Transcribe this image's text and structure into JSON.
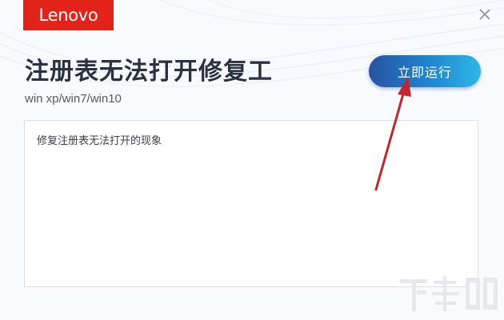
{
  "brand": {
    "logo_text": "Lenovo",
    "color": "#e2231a"
  },
  "window": {
    "close_icon": "close-icon"
  },
  "header": {
    "title": "注册表无法打开修复工",
    "subtitle": "win xp/win7/win10"
  },
  "actions": {
    "run_label": "立即运行"
  },
  "description": {
    "text": "修复注册表无法打开的现象"
  },
  "annotation": {
    "arrow_color": "#c1272d"
  },
  "watermark": {
    "text": "下载吧"
  }
}
